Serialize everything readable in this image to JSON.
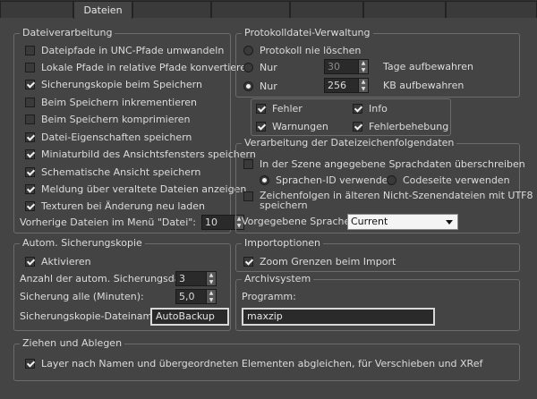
{
  "tabs": [
    {
      "label": "Dateien"
    }
  ],
  "file_processing": {
    "title": "Dateiverarbeitung",
    "options": [
      {
        "label": "Dateipfade in UNC-Pfade umwandeln",
        "checked": false
      },
      {
        "label": "Lokale Pfade in relative Pfade konvertieren",
        "checked": false
      },
      {
        "label": "Sicherungskopie beim Speichern",
        "checked": true
      },
      {
        "label": "Beim Speichern inkrementieren",
        "checked": false
      },
      {
        "label": "Beim Speichern komprimieren",
        "checked": false
      },
      {
        "label": "Datei-Eigenschaften speichern",
        "checked": true
      },
      {
        "label": "Miniaturbild des Ansichtsfensters speichern",
        "checked": true
      },
      {
        "label": "Schematische Ansicht speichern",
        "checked": true
      },
      {
        "label": "Meldung über veraltete Dateien anzeigen",
        "checked": true
      },
      {
        "label": "Texturen bei Änderung neu laden",
        "checked": true
      }
    ],
    "recent_files_label": "Vorherige Dateien im Menü \"Datei\":",
    "recent_files_value": "10"
  },
  "log_management": {
    "title": "Protokolldatei-Verwaltung",
    "never_delete_label": "Protokoll nie löschen",
    "only_label_1": "Nur",
    "days_value": "30",
    "days_suffix": "Tage aufbewahren",
    "only_label_2": "Nur",
    "kb_value": "256",
    "kb_suffix": "KB aufbewahren",
    "selected": "kb",
    "flags": {
      "errors": "Fehler",
      "info": "Info",
      "warnings": "Warnungen",
      "debug": "Fehlerbehebung"
    }
  },
  "language": {
    "title": "Verarbeitung der Dateizeichenfolgendaten",
    "override_label": "In der Szene angegebene Sprachdaten überschreiben",
    "use_language_id": "Sprachen-ID verwenden",
    "use_codepage": "Codeseite verwenden",
    "utf8_label_line1": "Zeichenfolgen in älteren Nicht-Szenendateien mit UTF8",
    "utf8_label_line2": "speichern",
    "default_language_label": "Vorgegebene Sprache:",
    "default_language_value": "Current"
  },
  "autobackup": {
    "title": "Autom. Sicherungskopie",
    "enable_label": "Aktivieren",
    "count_label": "Anzahl der autom. Sicherungsdat.:",
    "count_value": "3",
    "interval_label": "Sicherung alle (Minuten):",
    "interval_value": "5,0",
    "filename_label": "Sicherungskopie-Dateiname:",
    "filename_value": "AutoBackup"
  },
  "import_options": {
    "title": "Importoptionen",
    "zoom_label": "Zoom Grenzen beim Import"
  },
  "archive": {
    "title": "Archivsystem",
    "program_label": "Programm:",
    "program_value": "maxzip"
  },
  "drag_drop": {
    "title": "Ziehen und Ablegen",
    "match_label": "Layer nach Namen und übergeordneten Elementen abgleichen, für Verschieben und XRef"
  }
}
